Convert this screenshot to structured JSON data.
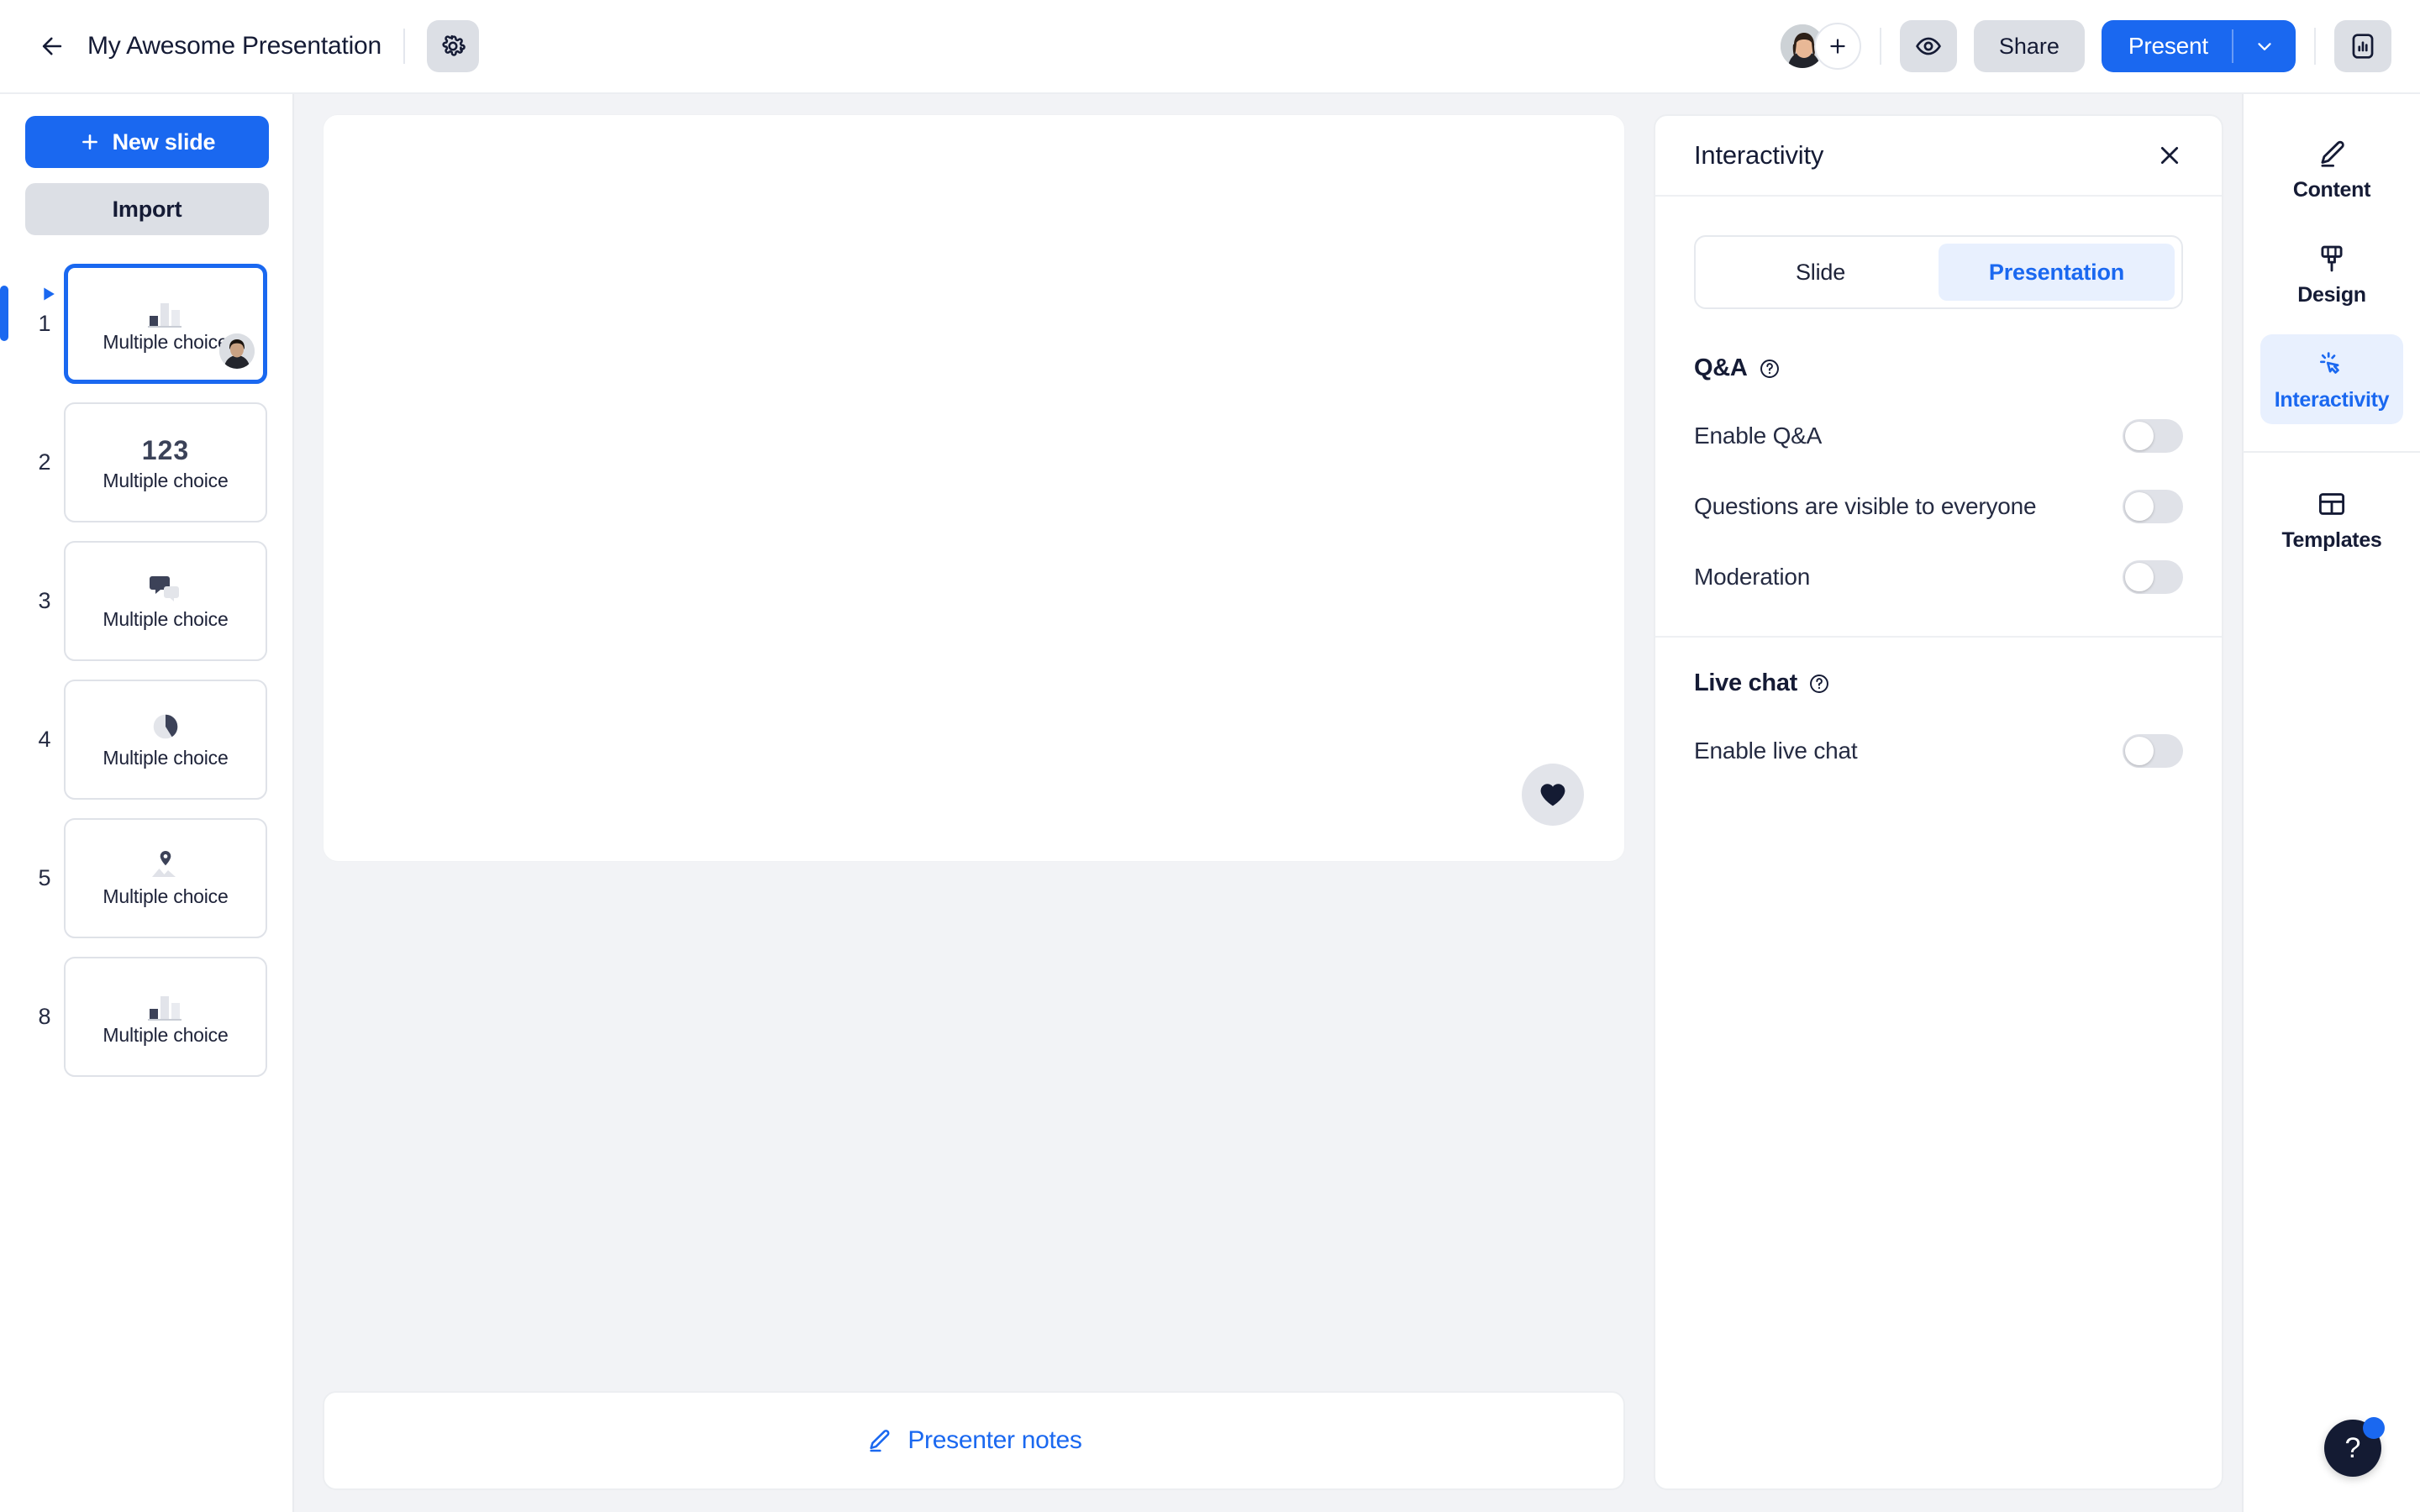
{
  "header": {
    "back_icon": "arrow-left-icon",
    "title": "My Awesome Presentation",
    "gear_icon": "gear-icon",
    "add_collaborator_icon": "plus-icon",
    "preview_icon": "eye-icon",
    "share_label": "Share",
    "present_label": "Present",
    "present_caret_icon": "chevron-down-icon",
    "analytics_icon": "bar-chart-icon"
  },
  "sidebar": {
    "new_slide_label": "New slide",
    "new_slide_icon": "plus-icon",
    "import_label": "Import",
    "active_slide": "1",
    "slides": [
      {
        "number": "1",
        "label": "Multiple choice",
        "icon": "bar-chart-icon",
        "active": true,
        "has_avatar": true
      },
      {
        "number": "2",
        "label": "Multiple choice",
        "icon": "numbers-123-icon",
        "icon_text": "123",
        "active": false,
        "has_avatar": false
      },
      {
        "number": "3",
        "label": "Multiple choice",
        "icon": "chat-bubbles-icon",
        "active": false,
        "has_avatar": false
      },
      {
        "number": "4",
        "label": "Multiple choice",
        "icon": "pie-chart-icon",
        "active": false,
        "has_avatar": false
      },
      {
        "number": "5",
        "label": "Multiple choice",
        "icon": "map-pin-image-icon",
        "active": false,
        "has_avatar": false
      },
      {
        "number": "8",
        "label": "Multiple choice",
        "icon": "bar-chart-icon",
        "active": false,
        "has_avatar": false
      }
    ]
  },
  "canvas": {
    "reaction_icon": "heart-icon"
  },
  "notes": {
    "icon": "pencil-icon",
    "label": "Presenter notes"
  },
  "panel": {
    "title": "Interactivity",
    "close_icon": "close-icon",
    "segments": [
      {
        "label": "Slide",
        "active": false
      },
      {
        "label": "Presentation",
        "active": true
      }
    ],
    "sections": [
      {
        "title": "Q&A",
        "help_icon": "question-circle-icon",
        "options": [
          {
            "label": "Enable Q&A",
            "enabled": false
          },
          {
            "label": "Questions are visible to everyone",
            "enabled": false
          },
          {
            "label": "Moderation",
            "enabled": false
          }
        ]
      },
      {
        "title": "Live chat",
        "help_icon": "question-circle-icon",
        "options": [
          {
            "label": "Enable live chat",
            "enabled": false
          }
        ]
      }
    ]
  },
  "rail": {
    "items": [
      {
        "label": "Content",
        "icon": "pencil-icon",
        "active": false
      },
      {
        "label": "Design",
        "icon": "paint-brush-icon",
        "active": false
      },
      {
        "label": "Interactivity",
        "icon": "interactivity-cursor-icon",
        "active": true
      },
      {
        "label": "Templates",
        "icon": "table-grid-icon",
        "active": false
      }
    ]
  },
  "help_fab": {
    "icon": "question-mark-icon",
    "label": "?",
    "has_badge": true
  },
  "colors": {
    "accent": "#1a68f0",
    "accent_soft": "#e8f0fe",
    "ink": "#151b35",
    "surface": "#f2f3f6",
    "control_grey": "#dcdfe5"
  }
}
